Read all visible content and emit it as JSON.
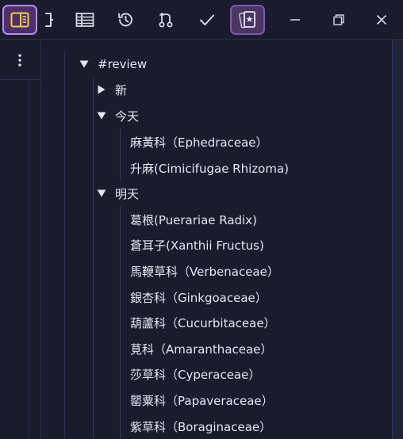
{
  "toolbar": {
    "buttons": [
      {
        "name": "sidebar-toggle-icon"
      },
      {
        "name": "bracket-icon"
      },
      {
        "name": "table-icon"
      },
      {
        "name": "history-icon"
      },
      {
        "name": "git-branch-icon"
      },
      {
        "name": "check-icon"
      },
      {
        "name": "flashcard-icon"
      },
      {
        "name": "minimize-icon"
      },
      {
        "name": "restore-icon"
      },
      {
        "name": "close-icon"
      }
    ]
  },
  "sidebar": {
    "menu_icon": "kebab-menu-icon"
  },
  "tree": {
    "root": {
      "label": "#review",
      "expanded": true
    },
    "groups": [
      {
        "label": "新",
        "expanded": false,
        "items": []
      },
      {
        "label": "今天",
        "expanded": true,
        "items": [
          "麻黃科（Ephedraceae）",
          "升麻(Cimicifugae Rhizoma)"
        ]
      },
      {
        "label": "明天",
        "expanded": true,
        "items": [
          "葛根(Puerariae Radix)",
          "蒼耳子(Xanthii Fructus)",
          "馬鞭草科（Verbenaceae）",
          "銀杏科（Ginkgoaceae）",
          "葫蘆科（Cucurbitaceae）",
          "莧科（Amaranthaceae）",
          "莎草科（Cyperaceae）",
          "罌粟科（Papaveraceae）",
          "紫草科（Boraginaceae）"
        ]
      }
    ]
  },
  "colors": {
    "background": "#1a1b2e",
    "accent_active": "#b98df0",
    "accent_yellow": "#f2c94c",
    "text": "#e6e6ef"
  }
}
